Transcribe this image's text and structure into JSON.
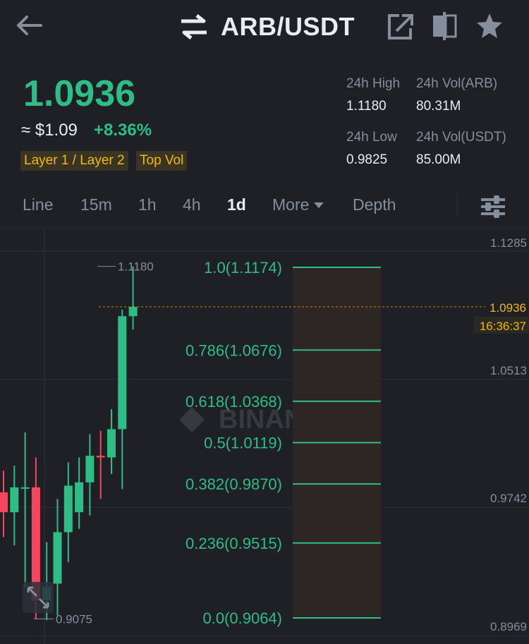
{
  "header": {
    "pair": "ARB/USDT",
    "icons": [
      "back-arrow-icon",
      "swap-arrows-icon",
      "share-icon",
      "compare-icon",
      "star-icon"
    ]
  },
  "ticker": {
    "last_price": "1.0936",
    "approx": "≈ $1.09",
    "change": "+8.36%",
    "tags": [
      "Layer 1 / Layer 2",
      "Top Vol"
    ],
    "stats": {
      "high_label": "24h High",
      "high": "1.1180",
      "vol_arb_label": "24h Vol(ARB)",
      "vol_arb": "80.31M",
      "low_label": "24h Low",
      "low": "0.9825",
      "vol_usdt_label": "24h Vol(USDT)",
      "vol_usdt": "85.00M"
    }
  },
  "tabs": {
    "line": "Line",
    "m15": "15m",
    "h1": "1h",
    "h4": "4h",
    "d1": "1d",
    "more": "More",
    "depth": "Depth"
  },
  "chart": {
    "axis": [
      "1.1285",
      "1.0513",
      "0.9742",
      "0.8969"
    ],
    "price_tag": "1.0936",
    "countdown": "16:36:37",
    "high_marker": "1.1180",
    "low_marker": "0.9075",
    "watermark": "BINANCE",
    "fib_levels": [
      {
        "label": "1.0(1.1174)",
        "price": 1.1174
      },
      {
        "label": "0.786(1.0676)",
        "price": 1.0676
      },
      {
        "label": "0.618(1.0368)",
        "price": 1.0368
      },
      {
        "label": "0.5(1.0119)",
        "price": 1.0119
      },
      {
        "label": "0.382(0.9870)",
        "price": 0.987
      },
      {
        "label": "0.236(0.9515)",
        "price": 0.9515
      },
      {
        "label": "0.0(0.9064)",
        "price": 0.9064
      }
    ],
    "candles": [
      {
        "o": 0.982,
        "h": 0.995,
        "l": 0.955,
        "c": 0.97
      },
      {
        "o": 0.97,
        "h": 0.998,
        "l": 0.95,
        "c": 0.985
      },
      {
        "o": 0.985,
        "h": 1.018,
        "l": 0.925,
        "c": 0.985
      },
      {
        "o": 0.985,
        "h": 1.003,
        "l": 0.906,
        "c": 0.917
      },
      {
        "o": 0.917,
        "h": 0.952,
        "l": 0.905,
        "c": 0.925
      },
      {
        "o": 0.927,
        "h": 0.978,
        "l": 0.908,
        "c": 0.958
      },
      {
        "o": 0.958,
        "h": 1.0,
        "l": 0.94,
        "c": 0.986
      },
      {
        "o": 0.97,
        "h": 1.003,
        "l": 0.96,
        "c": 0.988
      },
      {
        "o": 0.988,
        "h": 1.017,
        "l": 0.968,
        "c": 1.004
      },
      {
        "o": 1.004,
        "h": 1.019,
        "l": 0.978,
        "c": 1.003
      },
      {
        "o": 1.003,
        "h": 1.032,
        "l": 0.993,
        "c": 1.02
      },
      {
        "o": 1.02,
        "h": 1.092,
        "l": 0.984,
        "c": 1.088
      },
      {
        "o": 1.088,
        "h": 1.118,
        "l": 1.08,
        "c": 1.0936
      }
    ]
  }
}
